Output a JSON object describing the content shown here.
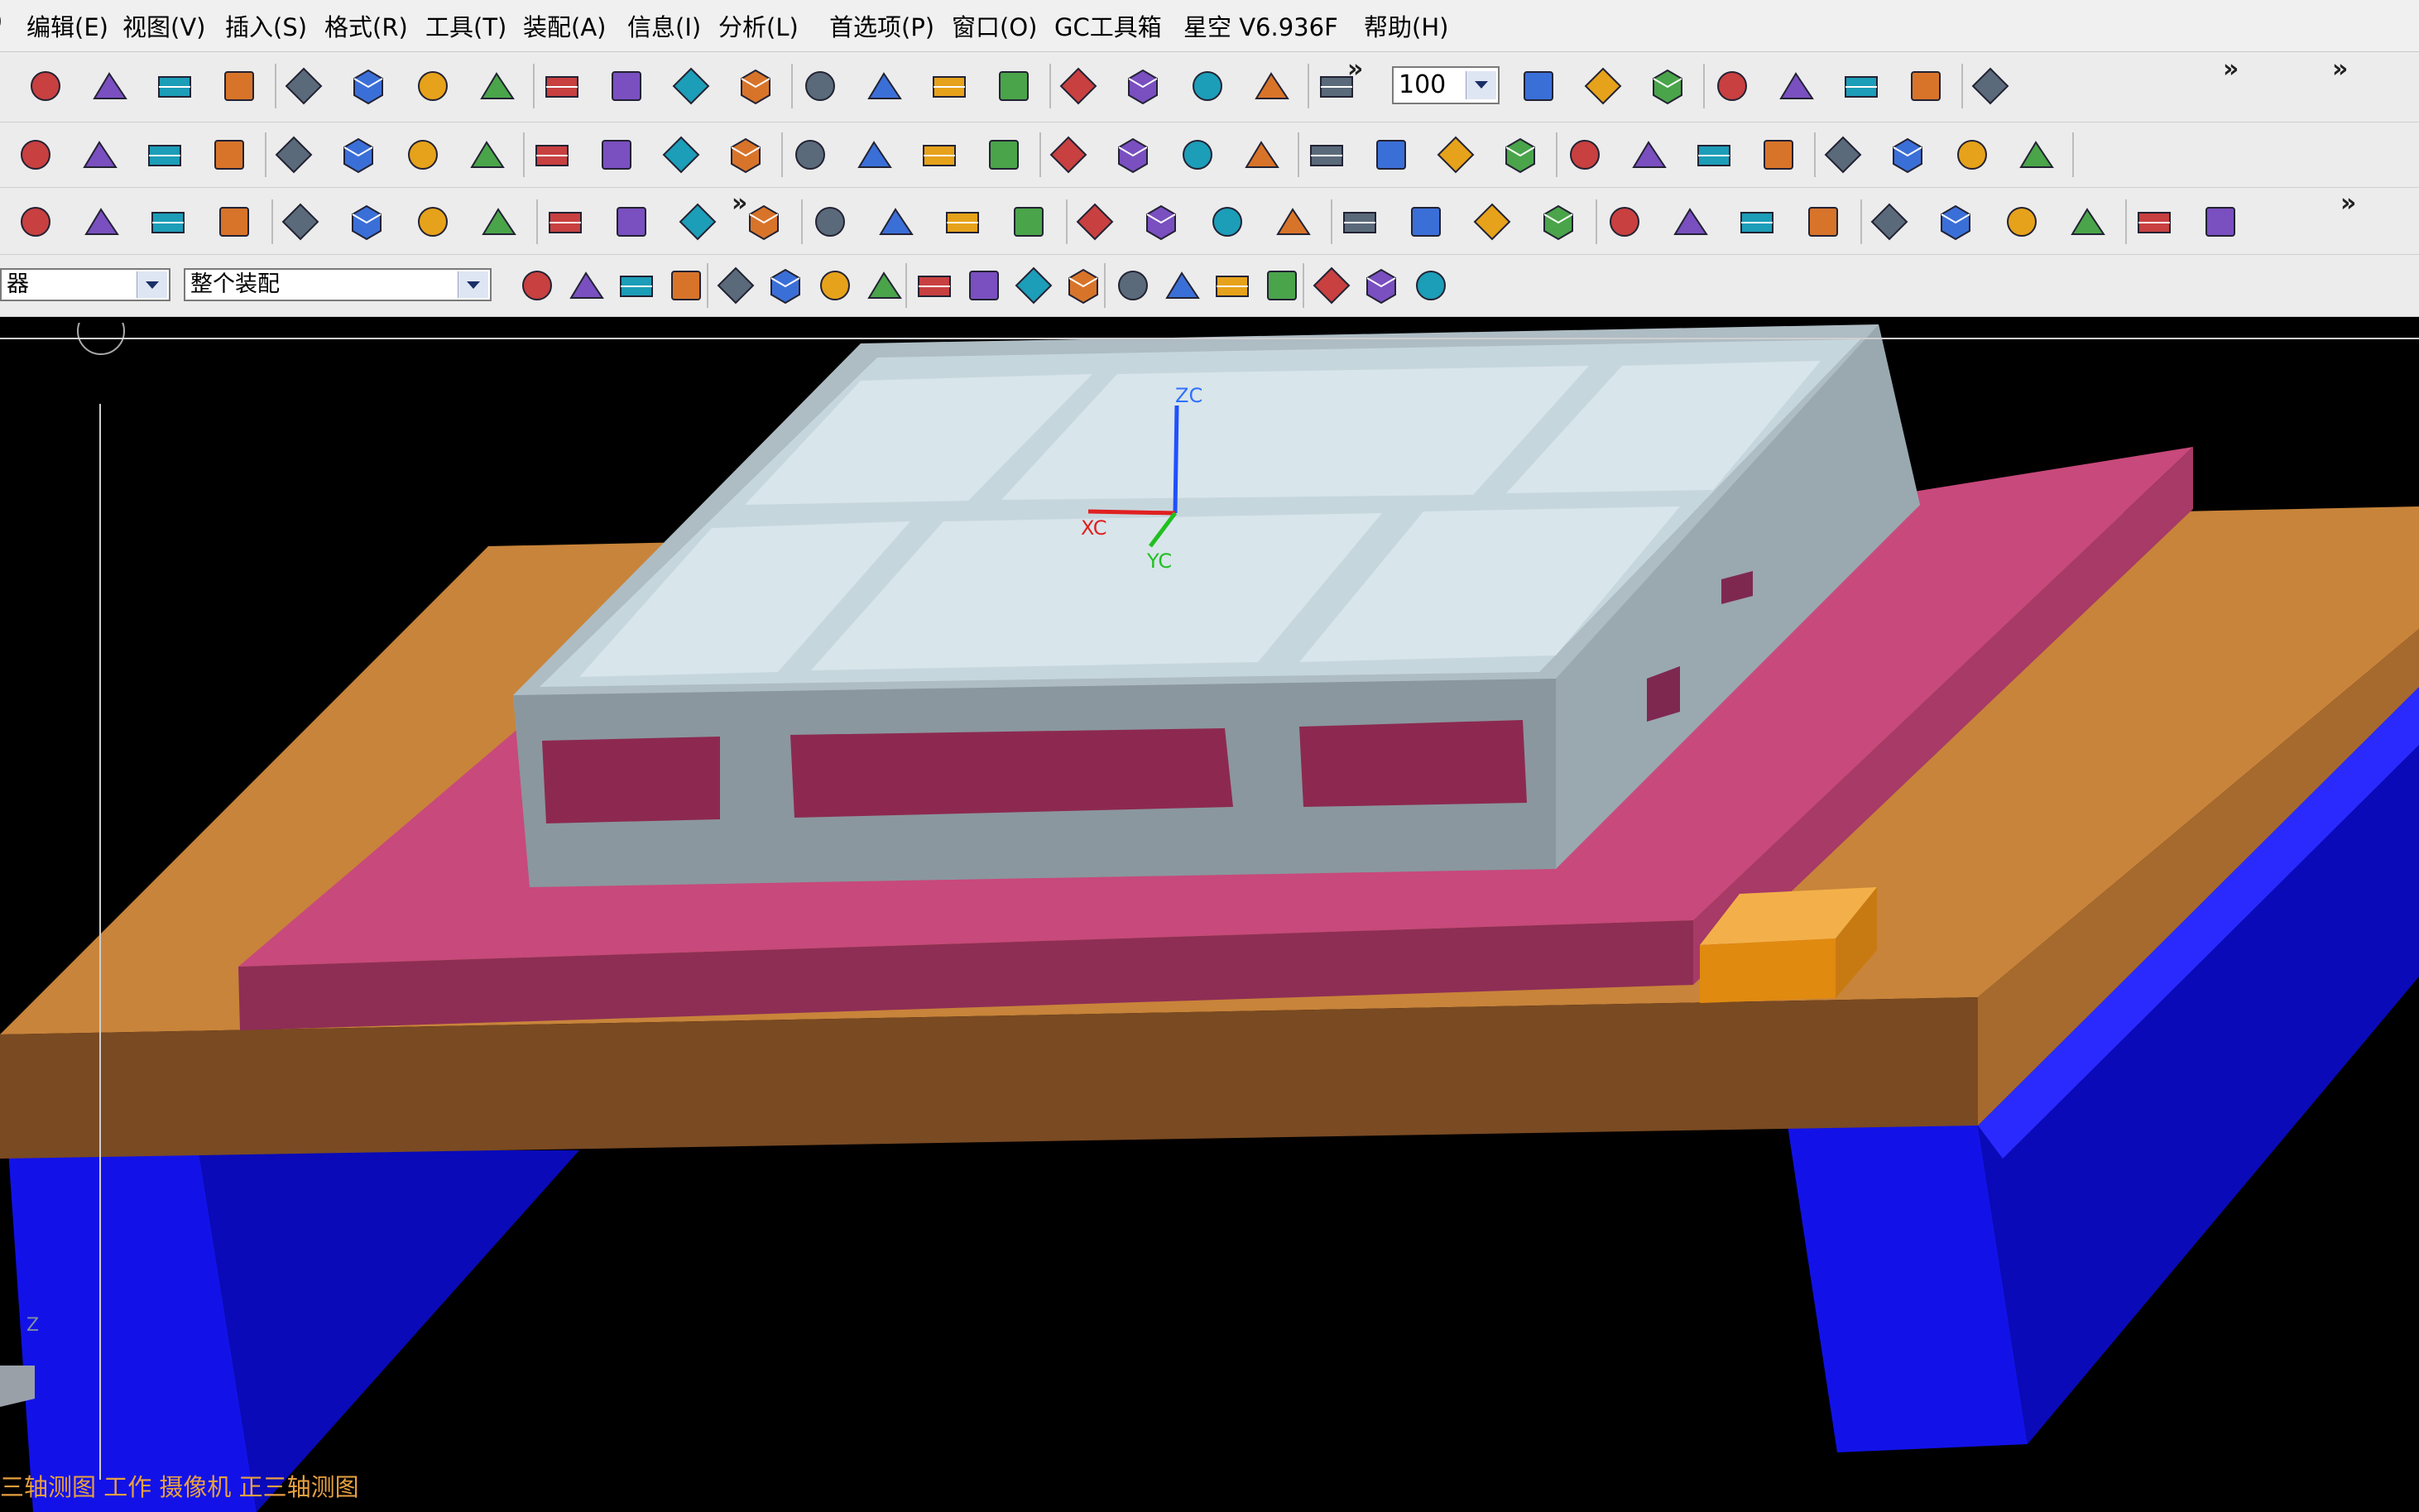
{
  "menubar": {
    "items": [
      "编辑(E)",
      "视图(V)",
      "插入(S)",
      "格式(R)",
      "工具(T)",
      "装配(A)",
      "信息(I)",
      "分析(L)",
      "首选项(P)",
      "窗口(O)",
      "GC工具箱",
      "星空 V6.936F",
      "帮助(H)"
    ]
  },
  "toolbar_standard": {
    "zoom_value": "100",
    "overflow_glyph": "»"
  },
  "selection_bar": {
    "filter_value": "器",
    "scope_value": "整个装配"
  },
  "viewport": {
    "triad": {
      "zc": "ZC",
      "yc": "YC",
      "xc": "XC"
    },
    "mini_axis_z": "Z",
    "colors": {
      "background": "#000000",
      "tray": "#b7c4cb",
      "tray_top": "#c5d5dc",
      "plate": "#c8497b",
      "base": "#c88538",
      "legs": "#1414ee",
      "block": "#f0a020"
    }
  },
  "status": {
    "text": "三轴测图 工作 摄像机 正三轴测图"
  },
  "icons": {
    "row1": [
      "new-icon",
      "open-icon",
      "save-icon",
      "print-icon",
      "copy-icon",
      "paste-icon",
      "delete-icon",
      "undo-icon",
      "redo-icon",
      "repeat-command-icon",
      "edit-object-icon",
      "zoom-icon",
      "fit-view-icon",
      "render-style-icon",
      "shaded-cube-icon",
      "wireframe-cube-icon",
      "hidden-edge-cube-icon",
      "orient-view-icon",
      "layer-settings-icon",
      "wcs-origin-icon",
      "wcs-dynamic-icon",
      "wcs-rotate-icon",
      "csys-icon",
      "measure-distance-icon",
      "analysis-icon",
      "ruler-icon",
      "snap-point-icon",
      "surface-icon",
      "solid-icon"
    ],
    "row2": [
      "assembly-nav-icon",
      "part-nav-icon",
      "drafting-icon",
      "modeling-icon",
      "gateway-icon",
      "extrude-icon",
      "revolve-icon",
      "datum-plane-icon",
      "sweep-icon",
      "hole-icon",
      "boss-icon",
      "pocket-icon",
      "pad-icon",
      "emboss-icon",
      "trim-icon",
      "blend-icon",
      "chamfer-icon",
      "shell-icon",
      "draft-icon",
      "offset-face-icon",
      "sew-icon",
      "sketch-icon",
      "curve-plane-icon",
      "mesh-surface-icon",
      "line-icon",
      "arc-icon",
      "spline-icon",
      "rectangle-icon",
      "polygon-icon",
      "helix-icon",
      "text-icon",
      "offset-curve-icon"
    ],
    "row3": [
      "book-icon",
      "mirror-icon",
      "component-icon",
      "pattern-icon",
      "check-icon",
      "mate-icon",
      "constrain-icon",
      "move-component-icon",
      "clone-icon",
      "explode-icon",
      "reposition-icon",
      "arrow-left-icon",
      "arrow-right-icon",
      "measure-icon",
      "point-icon",
      "datum-axis-icon",
      "block-icon",
      "variable-radius-icon",
      "bridge-icon",
      "color-icon",
      "feature-icon",
      "face-icon",
      "divide-icon",
      "offset-icon",
      "rect-sketch-icon",
      "hexagon-icon",
      "text-tool-icon",
      "erase-icon",
      "circle-icon",
      "cube-a-icon",
      "cube-b-icon",
      "cube-c-icon",
      "cylinder-icon",
      "cube-d-icon"
    ],
    "row4": [
      "filter-icon",
      "select-icon",
      "lasso-icon",
      "select-face-icon",
      "rect-select-icon",
      "cube-sel-icon",
      "cube-sel2-icon",
      "snap-grid-icon",
      "snap-line-icon",
      "snap-midline-icon",
      "snap-arc-icon",
      "snap-curve-icon",
      "snap-intersect-icon",
      "snap-center-icon",
      "snap-circle-icon",
      "snap-point-icon",
      "snap-tangent-icon",
      "snap-end-icon",
      "table-icon"
    ]
  }
}
